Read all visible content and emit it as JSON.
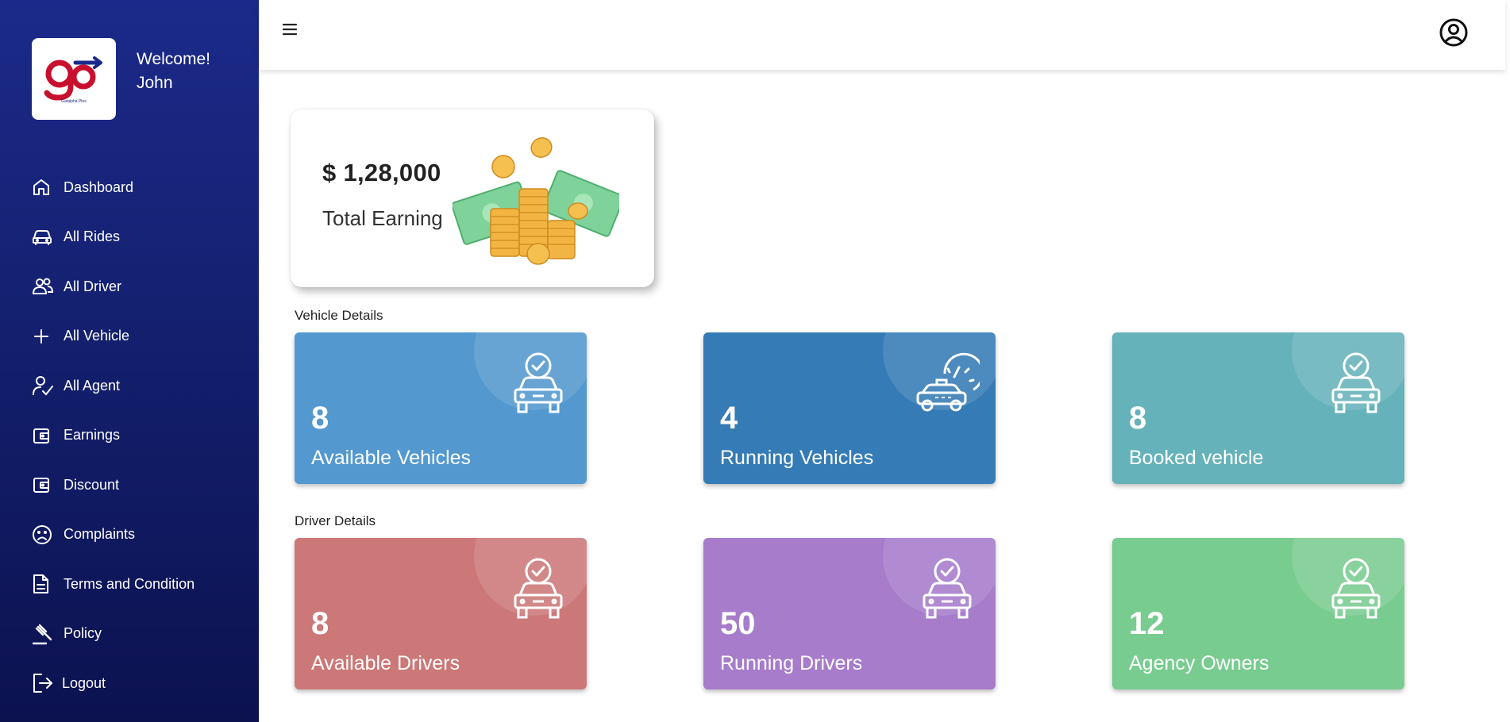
{
  "sidebar": {
    "logo_text": "go",
    "logo_subtext": "Gatalpha Plus",
    "welcome_line1": "Welcome!",
    "welcome_line2": "John",
    "items": [
      {
        "label": "Dashboard",
        "icon": "home-icon"
      },
      {
        "label": "All Rides",
        "icon": "car-icon"
      },
      {
        "label": "All Driver",
        "icon": "users-icon"
      },
      {
        "label": "All Vehicle",
        "icon": "plus-icon"
      },
      {
        "label": "All Agent",
        "icon": "user-check-icon"
      },
      {
        "label": "Earnings",
        "icon": "wallet-icon"
      },
      {
        "label": "Discount",
        "icon": "wallet-icon"
      },
      {
        "label": "Complaints",
        "icon": "sad-face-icon"
      },
      {
        "label": "Terms and Condition",
        "icon": "document-icon"
      },
      {
        "label": "Policy",
        "icon": "gavel-icon"
      },
      {
        "label": "Logout",
        "icon": "logout-icon"
      }
    ]
  },
  "topbar": {
    "menu_icon": "hamburger-menu-icon",
    "profile_icon": "user-circle-icon"
  },
  "earning": {
    "amount": "$ 1,28,000",
    "label": "Total Earning",
    "image": "money-stack-illustration"
  },
  "vehicle_section": {
    "title": "Vehicle Details",
    "cards": [
      {
        "value": "8",
        "label": "Available Vehicles",
        "color": "#5398cf",
        "icon": "car-check-icon"
      },
      {
        "value": "4",
        "label": "Running Vehicles",
        "color": "#357bb6",
        "icon": "taxi-speed-icon"
      },
      {
        "value": "8",
        "label": "Booked vehicle",
        "color": "#66b2ba",
        "icon": "car-check-icon"
      }
    ]
  },
  "driver_section": {
    "title": "Driver Details",
    "cards": [
      {
        "value": "8",
        "label": "Available Drivers",
        "color": "#cc7878",
        "icon": "car-check-icon"
      },
      {
        "value": "50",
        "label": "Running Drivers",
        "color": "#a77ccb",
        "icon": "car-check-icon"
      },
      {
        "value": "12",
        "label": "Agency Owners",
        "color": "#79cc90",
        "icon": "car-check-icon"
      }
    ]
  }
}
